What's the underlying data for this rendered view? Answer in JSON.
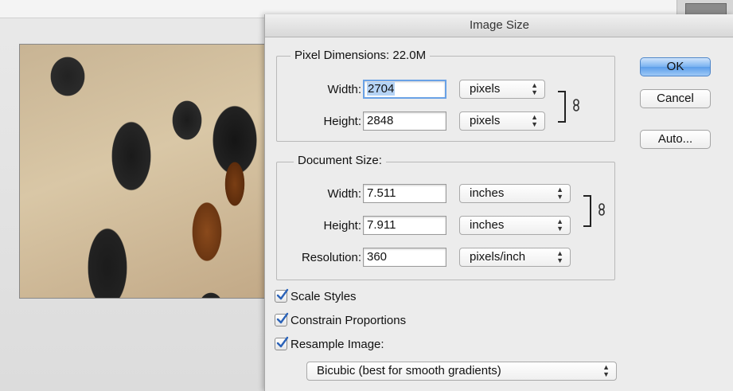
{
  "dialog": {
    "title": "Image Size",
    "pixel_dimensions": {
      "legend": "Pixel Dimensions:  22.0M",
      "width_label": "Width:",
      "width_value": "2704",
      "width_unit": "pixels",
      "height_label": "Height:",
      "height_value": "2848",
      "height_unit": "pixels"
    },
    "document_size": {
      "legend": "Document Size:",
      "width_label": "Width:",
      "width_value": "7.511",
      "width_unit": "inches",
      "height_label": "Height:",
      "height_value": "7.911",
      "height_unit": "inches",
      "resolution_label": "Resolution:",
      "resolution_value": "360",
      "resolution_unit": "pixels/inch"
    },
    "buttons": {
      "ok": "OK",
      "cancel": "Cancel",
      "auto": "Auto..."
    },
    "options": {
      "scale_styles": "Scale Styles",
      "constrain_proportions": "Constrain Proportions",
      "resample_image": "Resample Image:",
      "resample_method": "Bicubic (best for smooth gradients)"
    },
    "icons": {
      "link": "link-icon",
      "checkmark": "checkmark-icon",
      "popup_arrows": "up-down-arrows-icon"
    },
    "colors": {
      "default_button": "#5c9eea",
      "focus_ring": "#6aa2e6",
      "checkmark": "#2a62b8"
    }
  }
}
